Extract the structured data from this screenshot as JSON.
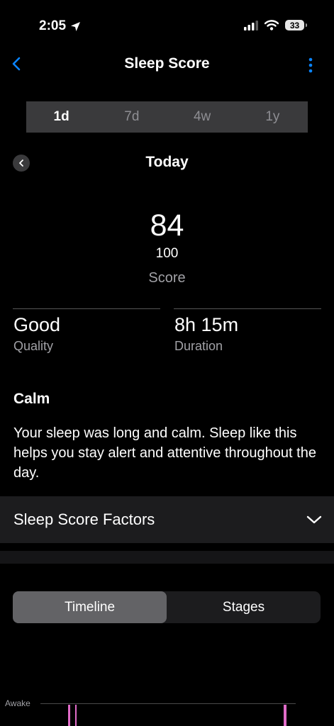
{
  "status_bar": {
    "time": "2:05",
    "battery": "33"
  },
  "nav": {
    "title": "Sleep Score"
  },
  "period_tabs": [
    {
      "label": "1d",
      "active": true
    },
    {
      "label": "7d",
      "active": false
    },
    {
      "label": "4w",
      "active": false
    },
    {
      "label": "1y",
      "active": false
    }
  ],
  "date": {
    "title": "Today"
  },
  "score": {
    "value": "84",
    "max": "100",
    "label": "Score"
  },
  "stats": {
    "quality": {
      "value": "Good",
      "label": "Quality"
    },
    "duration": {
      "value": "8h 15m",
      "label": "Duration"
    }
  },
  "summary": {
    "title": "Calm",
    "description": "Your sleep was long and calm. Sleep like this helps you stay alert and attentive throughout the day."
  },
  "factors": {
    "label": "Sleep Score Factors"
  },
  "view_tabs": [
    {
      "label": "Timeline",
      "active": true
    },
    {
      "label": "Stages",
      "active": false
    }
  ],
  "chart": {
    "awake_label": "Awake"
  },
  "colors": {
    "accent_blue": "#0a84ff",
    "awake_pink": "#e06cc8"
  }
}
